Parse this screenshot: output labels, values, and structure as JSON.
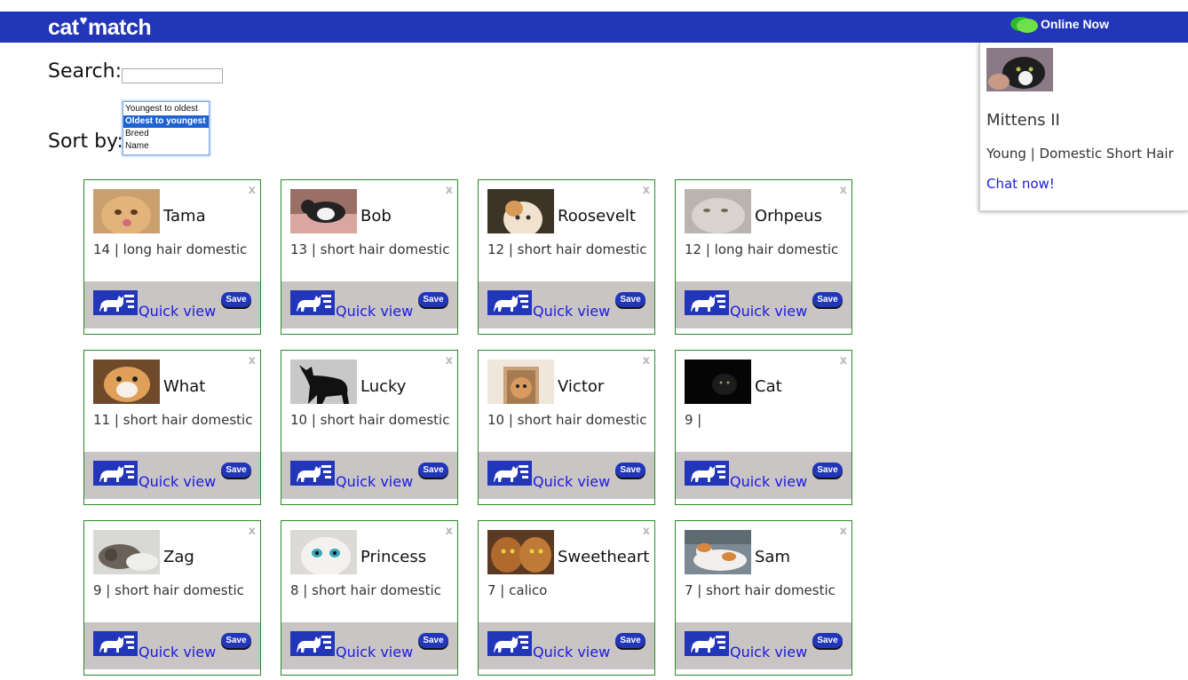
{
  "header": {
    "logo_left": "cat",
    "logo_heart": "♥",
    "logo_right": "match",
    "online_label": "Online Now",
    "online_icon": "chat-bubbles-icon",
    "bar_color": "#2236b9"
  },
  "search": {
    "label": "Search:",
    "value": ""
  },
  "sort": {
    "label": "Sort by:",
    "options": [
      "Youngest to oldest",
      "Oldest to youngest",
      "Breed",
      "Name"
    ],
    "selected": "Oldest to youngest"
  },
  "card_actions": {
    "close": "x",
    "quick_view": "Quick view",
    "save": "Save",
    "quick_view_icon": "cat-id-card-icon"
  },
  "cats": [
    {
      "name": "Tama",
      "info": "14 | long hair domestic"
    },
    {
      "name": "Bob",
      "info": "13 | short hair domestic"
    },
    {
      "name": "Roosevelt",
      "info": "12 | short hair domestic"
    },
    {
      "name": "Orhpeus",
      "info": "12 | long hair domestic"
    },
    {
      "name": "What",
      "info": "11 | short hair domestic"
    },
    {
      "name": "Lucky",
      "info": "10 | short hair domestic"
    },
    {
      "name": "Victor",
      "info": "10 | short hair domestic"
    },
    {
      "name": "Cat",
      "info": "9 |"
    },
    {
      "name": "Zag",
      "info": "9 | short hair domestic"
    },
    {
      "name": "Princess",
      "info": "8 | short hair domestic"
    },
    {
      "name": "Sweetheart",
      "info": "7 | calico"
    },
    {
      "name": "Sam",
      "info": "7 | short hair domestic"
    }
  ],
  "online_now": {
    "name": "Mittens II",
    "info": "Young | Domestic Short Hair",
    "chat_link": "Chat now!"
  }
}
